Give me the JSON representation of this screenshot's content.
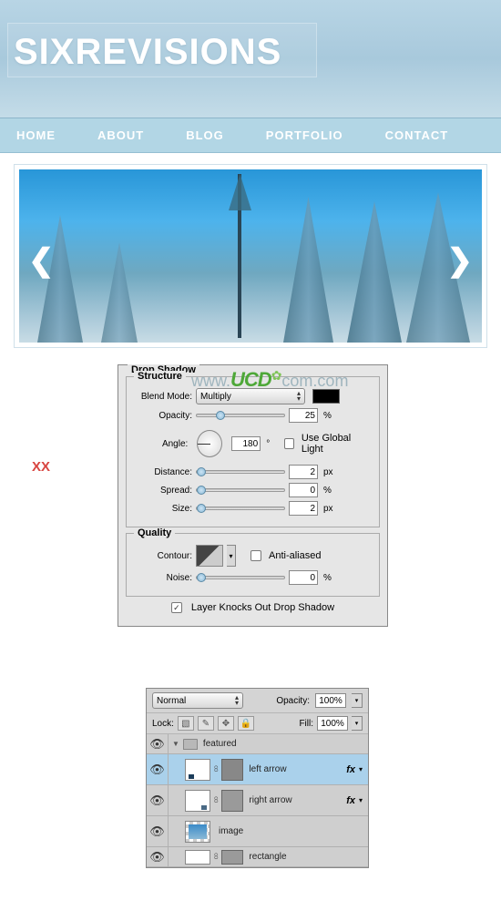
{
  "banner": {
    "title": "SIXREVISIONS"
  },
  "nav": [
    "HOME",
    "ABOUT",
    "BLOG",
    "PORTFOLIO",
    "CONTACT"
  ],
  "xx": "XX",
  "watermark": {
    "ucd": "UCD",
    "rest": "com.com",
    "www": "www."
  },
  "dropShadow": {
    "panelTitle": "Drop Shadow",
    "structureLabel": "Structure",
    "blendModeLabel": "Blend Mode:",
    "blendModeValue": "Multiply",
    "opacityLabel": "Opacity:",
    "opacityValue": "25",
    "opacityUnit": "%",
    "angleLabel": "Angle:",
    "angleValue": "180",
    "angleUnit": "°",
    "useGlobalLabel": "Use Global Light",
    "useGlobalChecked": false,
    "distanceLabel": "Distance:",
    "distanceValue": "2",
    "distanceUnit": "px",
    "spreadLabel": "Spread:",
    "spreadValue": "0",
    "spreadUnit": "%",
    "sizeLabel": "Size:",
    "sizeValue": "2",
    "sizeUnit": "px",
    "qualityLabel": "Quality",
    "contourLabel": "Contour:",
    "antiAliasedLabel": "Anti-aliased",
    "antiAliasedChecked": false,
    "noiseLabel": "Noise:",
    "noiseValue": "0",
    "noiseUnit": "%",
    "knockoutLabel": "Layer Knocks Out Drop Shadow",
    "knockoutChecked": true
  },
  "layersPanel": {
    "blendMode": "Normal",
    "opacityLabel": "Opacity:",
    "opacityValue": "100%",
    "lockLabel": "Lock:",
    "fillLabel": "Fill:",
    "fillValue": "100%",
    "groupName": "featured",
    "layers": [
      {
        "name": "left arrow",
        "fx": true,
        "selected": true
      },
      {
        "name": "right arrow",
        "fx": true,
        "selected": false
      },
      {
        "name": "image",
        "fx": false,
        "selected": false
      },
      {
        "name": "rectangle",
        "fx": false,
        "selected": false
      }
    ]
  }
}
